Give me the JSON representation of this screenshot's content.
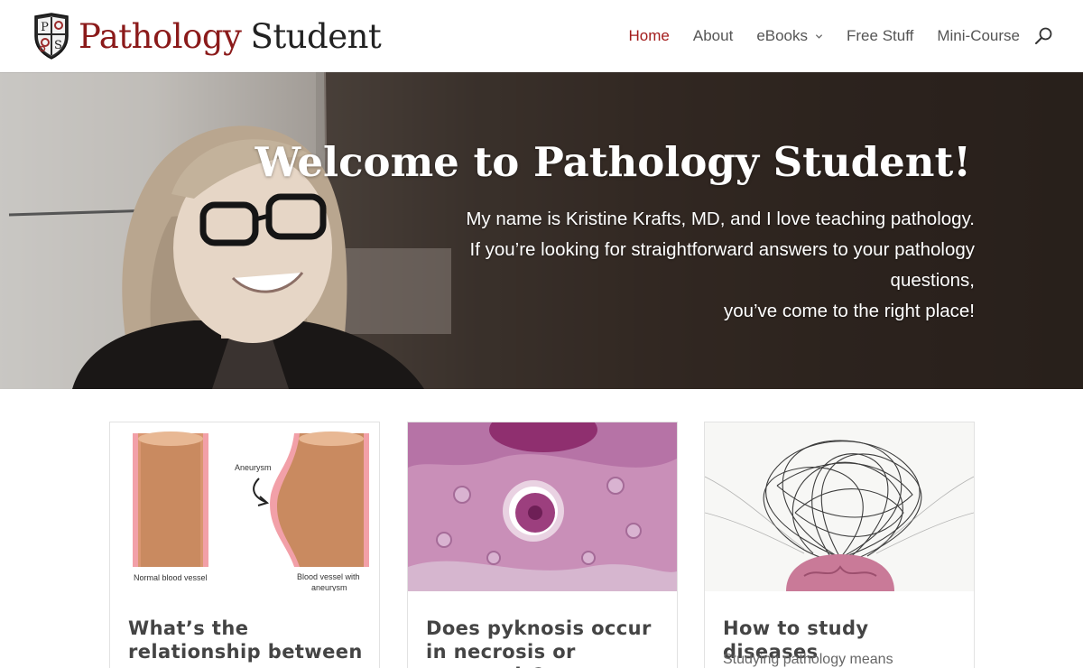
{
  "site": {
    "logo_word1": "Pathology",
    "logo_word2": "Student",
    "logo_shield_letters": [
      "P",
      "S"
    ]
  },
  "nav": {
    "items": [
      {
        "label": "Home",
        "active": true
      },
      {
        "label": "About"
      },
      {
        "label": "eBooks",
        "has_dropdown": true
      },
      {
        "label": "Free Stuff"
      },
      {
        "label": "Mini-Course"
      }
    ],
    "search_icon": "search-icon",
    "accent_color": "#a31c1c"
  },
  "hero": {
    "title": "Welcome to Pathology Student!",
    "lines": [
      "My name is Kristine Krafts, MD, and I love teaching pathology.",
      "If you’re looking for straightforward answers to your pathology",
      "questions,",
      "you’ve come to the right place!"
    ]
  },
  "cards": [
    {
      "title": "What’s the relationship between aneurysm,",
      "excerpt": "",
      "image_labels": {
        "aneurysm": "Aneurysm",
        "normal": "Normal blood vessel",
        "with_1": "Blood vessel with",
        "with_2": "aneurysm"
      }
    },
    {
      "title": "Does pyknosis occur in necrosis or apoptosis?",
      "excerpt": ""
    },
    {
      "title": "How to study diseases",
      "excerpt": "Studying pathology means"
    }
  ]
}
